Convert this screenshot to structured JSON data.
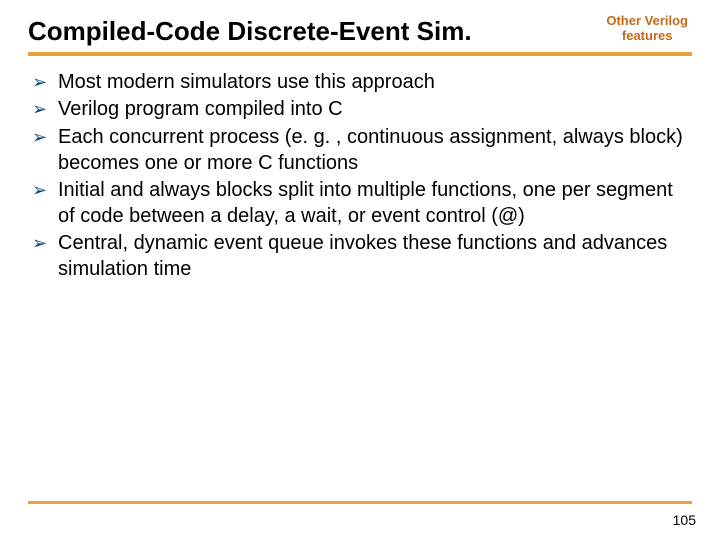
{
  "header": {
    "title": "Compiled-Code Discrete-Event Sim.",
    "corner_line1": "Other Verilog",
    "corner_line2": "features"
  },
  "bullets": [
    "Most modern simulators use this approach",
    "Verilog program compiled into C",
    "Each concurrent process (e. g. , continuous assignment, always block) becomes one or more C functions",
    "Initial and always blocks split into multiple functions, one per segment of code between a delay, a wait, or event control (@)",
    "Central, dynamic event queue invokes these functions and advances simulation time"
  ],
  "page_number": "105",
  "colors": {
    "accent": "#e8a23d",
    "bullet": "#0a4a7a",
    "corner": "#c26a1a"
  }
}
